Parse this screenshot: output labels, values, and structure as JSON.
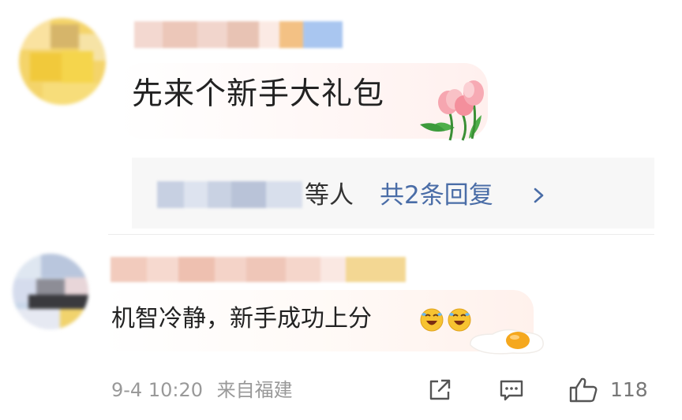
{
  "comments": [
    {
      "text": "先来个新手大礼包",
      "sticker": "tulip-flower-sticker",
      "reply_summary": {
        "suffix": "等人",
        "more_link": "共2条回复"
      }
    },
    {
      "text": "机智冷静，新手成功上分",
      "emojis": [
        "laughing-crying-emoji",
        "laughing-crying-emoji"
      ],
      "sticker": "fried-egg-sticker",
      "time": "9-4 10:20",
      "location": "来自福建",
      "like_count": "118"
    }
  ],
  "icons": {
    "share": "share-icon",
    "comment": "comment-icon",
    "like": "thumbs-up-icon",
    "more": "chevron-right-icon"
  },
  "colors": {
    "link": "#4a6da7",
    "meta": "#999999",
    "reply_bg": "#f7f7f7"
  }
}
